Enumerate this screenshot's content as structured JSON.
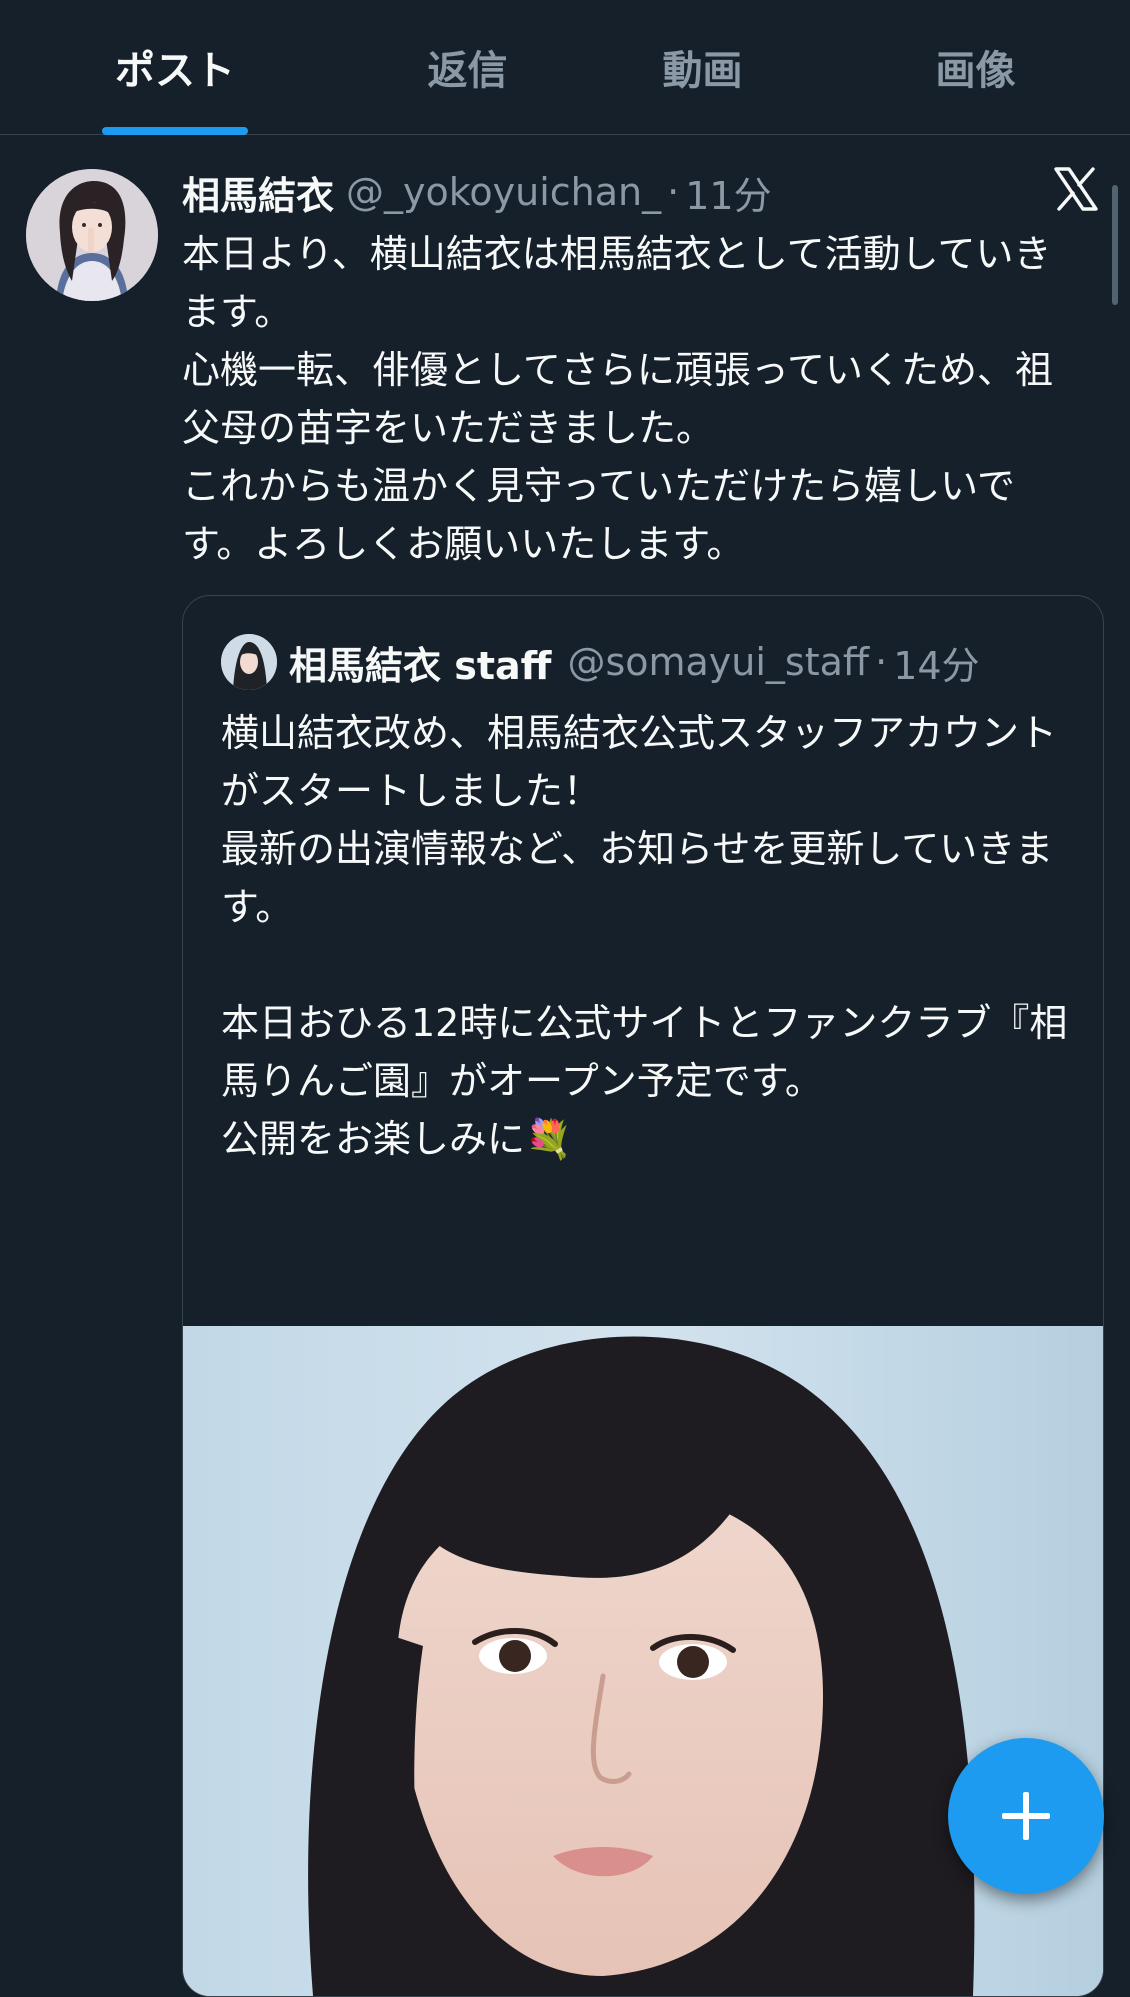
{
  "tabs": [
    {
      "label": "ポスト",
      "active": true
    },
    {
      "label": "返信",
      "active": false
    },
    {
      "label": "動画",
      "active": false
    },
    {
      "label": "画像",
      "active": false
    }
  ],
  "post": {
    "display_name": "相馬結衣",
    "handle": "@_yokoyuichan_",
    "separator": "·",
    "time": "11分",
    "text": "本日より、横山結衣は相馬結衣として活動していきます。\n心機一転、俳優としてさらに頑張っていくため、祖父母の苗字をいただきました。\nこれからも温かく見守っていただけたら嬉しいです。よろしくお願いいたします。",
    "avatar_icon": "profile-photo",
    "logo_icon": "x-logo-icon"
  },
  "quote": {
    "display_name": "相馬結衣 staff",
    "handle": "@somayui_staff",
    "separator": "·",
    "time": "14分",
    "text": "横山結衣改め、相馬結衣公式スタッフアカウントがスタートしました！\n最新の出演情報など、お知らせを更新していきます。\n\n本日おひる12時に公式サイトとファンクラブ『相馬りんご園』がオープン予定です。\n公開をお楽しみに💐",
    "image_icon": "portrait-photo"
  },
  "fab": {
    "icon": "plus-icon"
  },
  "colors": {
    "background": "#15202b",
    "accent": "#1d9bf0",
    "secondary_text": "#8b98a5",
    "border": "#38444d"
  }
}
